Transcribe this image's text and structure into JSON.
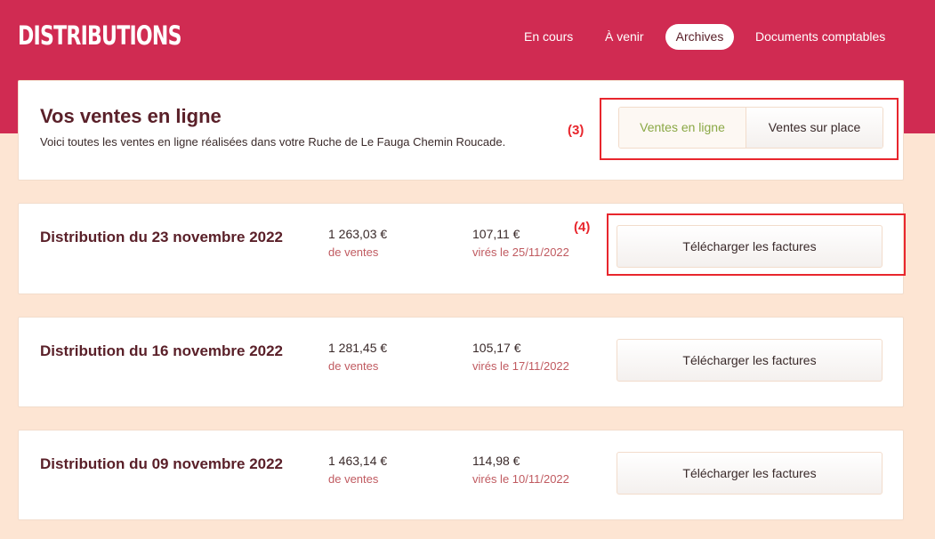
{
  "header": {
    "logo": "DISTRIBUTIONS",
    "nav": [
      {
        "label": "En cours"
      },
      {
        "label": "À venir"
      },
      {
        "label": "Archives"
      },
      {
        "label": "Documents comptables"
      }
    ],
    "active_tab": "Archives"
  },
  "summary": {
    "title": "Vos ventes en ligne",
    "description": "Voici toutes les ventes en ligne réalisées dans votre Ruche de Le Fauga Chemin Roucade.",
    "toggle": {
      "options": [
        "Ventes en ligne",
        "Ventes sur place"
      ],
      "selected": "Ventes en ligne"
    }
  },
  "annotations": {
    "label_3": "(3)",
    "label_4": "(4)"
  },
  "distributions": [
    {
      "title": "Distribution du 23 novembre 2022",
      "sales_amount": "1 263,03 €",
      "sales_label": "de ventes",
      "transfer_amount": "107,11 €",
      "transfer_label": "virés le 25/11/2022",
      "button": "Télécharger les factures"
    },
    {
      "title": "Distribution du 16 novembre 2022",
      "sales_amount": "1 281,45 €",
      "sales_label": "de ventes",
      "transfer_amount": "105,17 €",
      "transfer_label": "virés le 17/11/2022",
      "button": "Télécharger les factures"
    },
    {
      "title": "Distribution du 09 novembre 2022",
      "sales_amount": "1 463,14 €",
      "sales_label": "de ventes",
      "transfer_amount": "114,98 €",
      "transfer_label": "virés le 10/11/2022",
      "button": "Télécharger les factures"
    }
  ],
  "colors": {
    "brand": "#d02b52",
    "background": "#fde5d3",
    "title": "#5a2029",
    "accent_green": "#8aa845",
    "annotation_red": "#e8262d"
  }
}
